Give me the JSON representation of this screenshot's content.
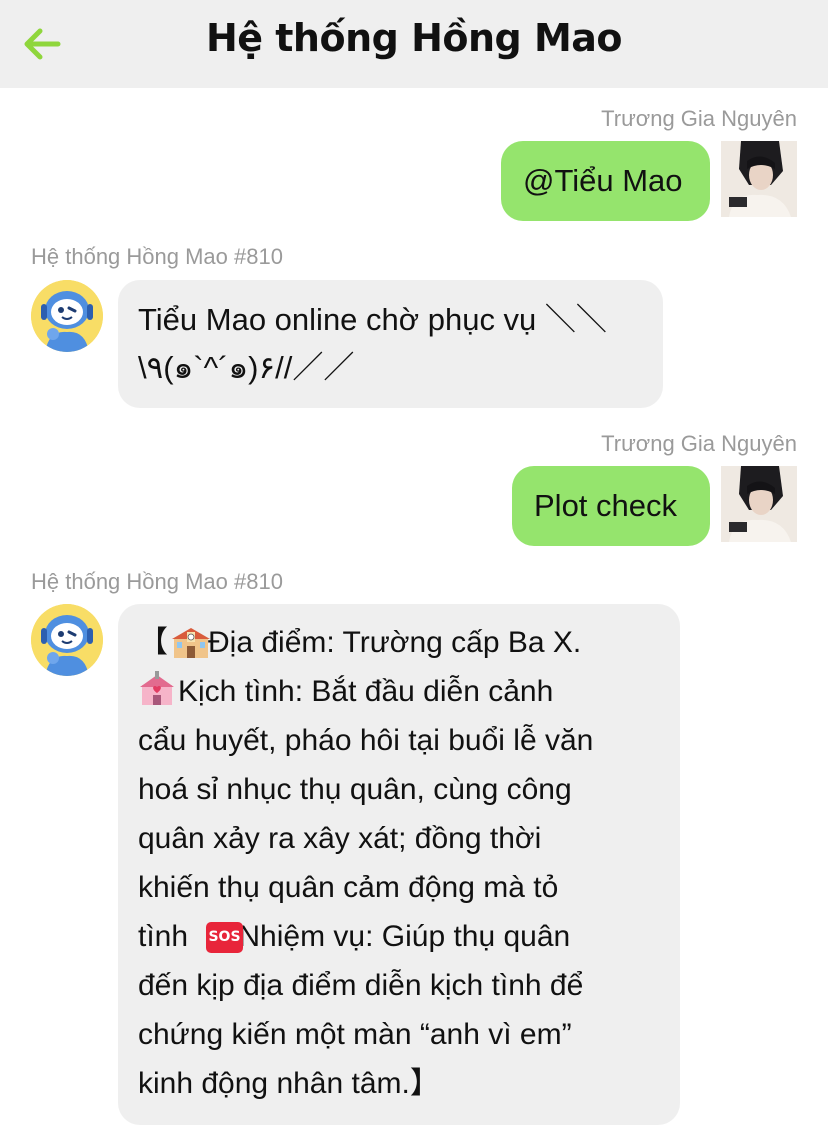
{
  "header": {
    "title": "Hệ thống Hồng Mao",
    "back_icon": "arrow-left-icon",
    "accent": "#8fd63c"
  },
  "messages": [
    {
      "side": "right",
      "sender": "Trương Gia Nguyên",
      "text": "@Tiểu Mao"
    },
    {
      "side": "left",
      "sender": "Hệ thống Hồng Mao #810",
      "lines": [
        "Tiểu Mao online chờ phục vụ ＼＼",
        "\\٩(๑`^´๑)۶//／／"
      ]
    },
    {
      "side": "right",
      "sender": "Trương Gia Nguyên",
      "text": "Plot check"
    },
    {
      "side": "left",
      "sender": "Hệ thống Hồng Mao #810",
      "lines": [
        " 【Địa điểm: Trường cấp Ba X.",
        "Kịch tình: Bắt đầu diễn cảnh",
        "cẩu huyết, pháo hôi tại buổi lễ văn",
        "hoá sỉ nhục thụ quân, cùng công",
        "quân xảy ra xây xát; đồng thời",
        "khiến thụ quân cảm động mà tỏ",
        "tình Nhiệm vụ: Giúp thụ quân",
        "đến kịp địa điểm diễn kịch tình để",
        "chứng kiến một màn “anh vì em”",
        "kinh động nhân tâm.】"
      ],
      "icons": [
        "school-icon",
        "wedding-chapel-icon",
        "sos-icon"
      ],
      "sos_label": "SOS"
    }
  ],
  "colors": {
    "user_bubble": "#95e46d",
    "bot_bubble": "#efefef",
    "sender": "#9a9a9a"
  }
}
